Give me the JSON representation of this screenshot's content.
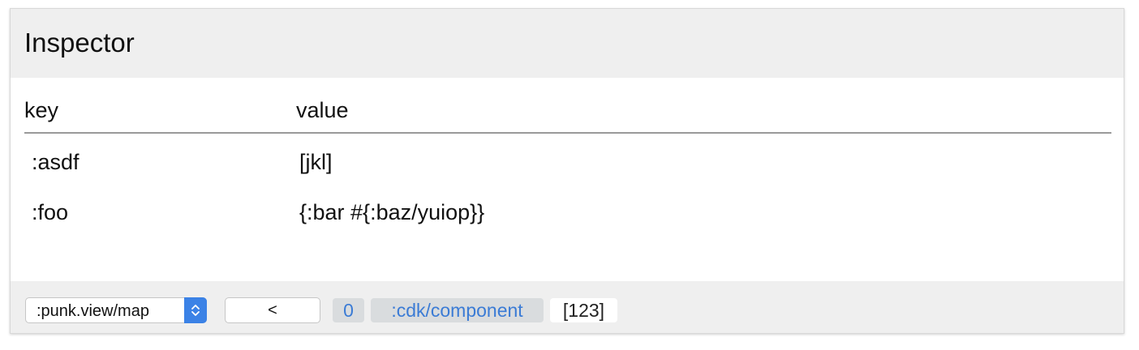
{
  "header": {
    "title": "Inspector"
  },
  "table": {
    "columns": {
      "key": "key",
      "value": "value"
    },
    "rows": [
      {
        "key": ":asdf",
        "value": "[jkl]"
      },
      {
        "key": ":foo",
        "value": "{:bar #{:baz/yuiop}}"
      }
    ]
  },
  "footer": {
    "view_select": {
      "selected": ":punk.view/map"
    },
    "back_label": "<",
    "history_index": "0",
    "component_tag": ":cdk/component",
    "value_tag": "[123]"
  },
  "colors": {
    "accent": "#3b82e6",
    "link": "#3a7bd5",
    "chrome": "#efefef"
  }
}
